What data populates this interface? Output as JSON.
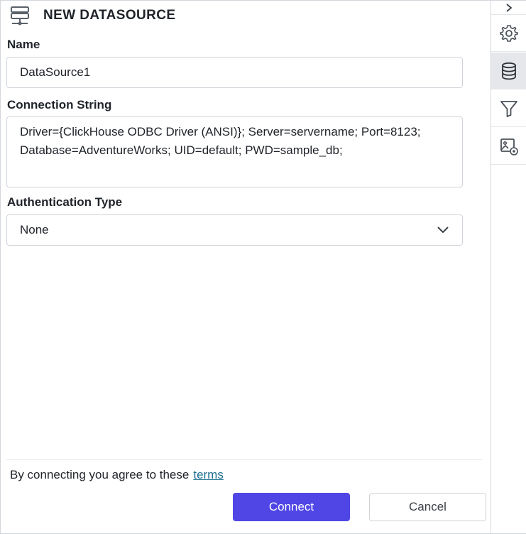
{
  "header": {
    "title": "NEW DATASOURCE",
    "icon": "server-icon"
  },
  "form": {
    "name_label": "Name",
    "name_value": "DataSource1",
    "connection_label": "Connection String",
    "connection_value": "Driver={ClickHouse ODBC Driver (ANSI)}; Server=servername; Port=8123; Database=AdventureWorks; UID=default; PWD=sample_db;",
    "auth_label": "Authentication Type",
    "auth_value": "None"
  },
  "footer": {
    "terms_text": "By connecting you agree to these",
    "terms_link": "terms",
    "connect_label": "Connect",
    "cancel_label": "Cancel"
  },
  "sidebar": {
    "items": [
      {
        "icon": "gear-icon",
        "active": false
      },
      {
        "icon": "database-icon",
        "active": true
      },
      {
        "icon": "filter-icon",
        "active": false
      },
      {
        "icon": "image-settings-icon",
        "active": false
      }
    ]
  },
  "colors": {
    "accent": "#4f46e5",
    "link": "#1c6f8f",
    "active_bg": "#e6e7ea",
    "border": "#d0d4da"
  }
}
